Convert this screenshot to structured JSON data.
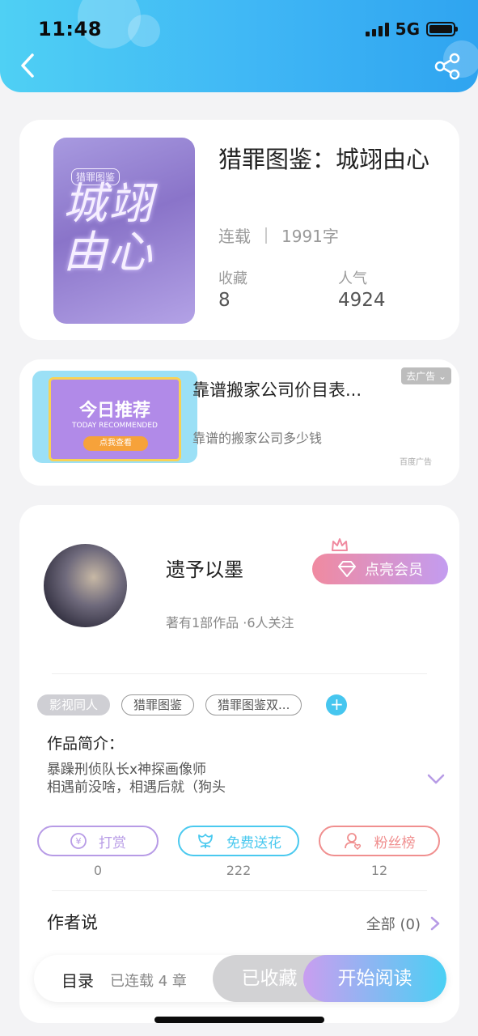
{
  "status": {
    "time": "11:48",
    "network": "5G"
  },
  "book": {
    "title": "猎罪图鉴：城翊由心",
    "status": "连载",
    "words": "1991字",
    "fav_label": "收藏",
    "fav_value": "8",
    "pop_label": "人气",
    "pop_value": "4924",
    "cover_small": "猎罪图鉴",
    "cover_big": "城翊由心"
  },
  "ad": {
    "title": "靠谱搬家公司价目表...",
    "subtitle": "靠谱的搬家公司多少钱",
    "close_tag": "去广告",
    "source": "百度广告",
    "img_title": "今日推荐",
    "img_sub": "TODAY RECOMMENDED",
    "img_btn": "点我查看"
  },
  "author": {
    "name": "遗予以墨",
    "vip_label": "点亮会员",
    "info": "著有1部作品 ·6人关注"
  },
  "tags": [
    "影视同人",
    "猎罪图鉴",
    "猎罪图鉴双..."
  ],
  "intro": {
    "heading": "作品简介：",
    "line1": "暴躁刑侦队长x神探画像师",
    "line2": "相遇前没啥，相遇后就（狗头"
  },
  "actions": [
    {
      "label": "打赏",
      "count": "0",
      "color": "#b79be6"
    },
    {
      "label": "免费送花",
      "count": "222",
      "color": "#4ac9ef"
    },
    {
      "label": "粉丝榜",
      "count": "12",
      "color": "#f08f8f"
    }
  ],
  "author_say": {
    "title": "作者说",
    "all": "全部 (0)"
  },
  "bottom_bar": {
    "toc": "目录",
    "chapters": "已连载 4 章",
    "collected": "已收藏",
    "read": "开始阅读"
  }
}
